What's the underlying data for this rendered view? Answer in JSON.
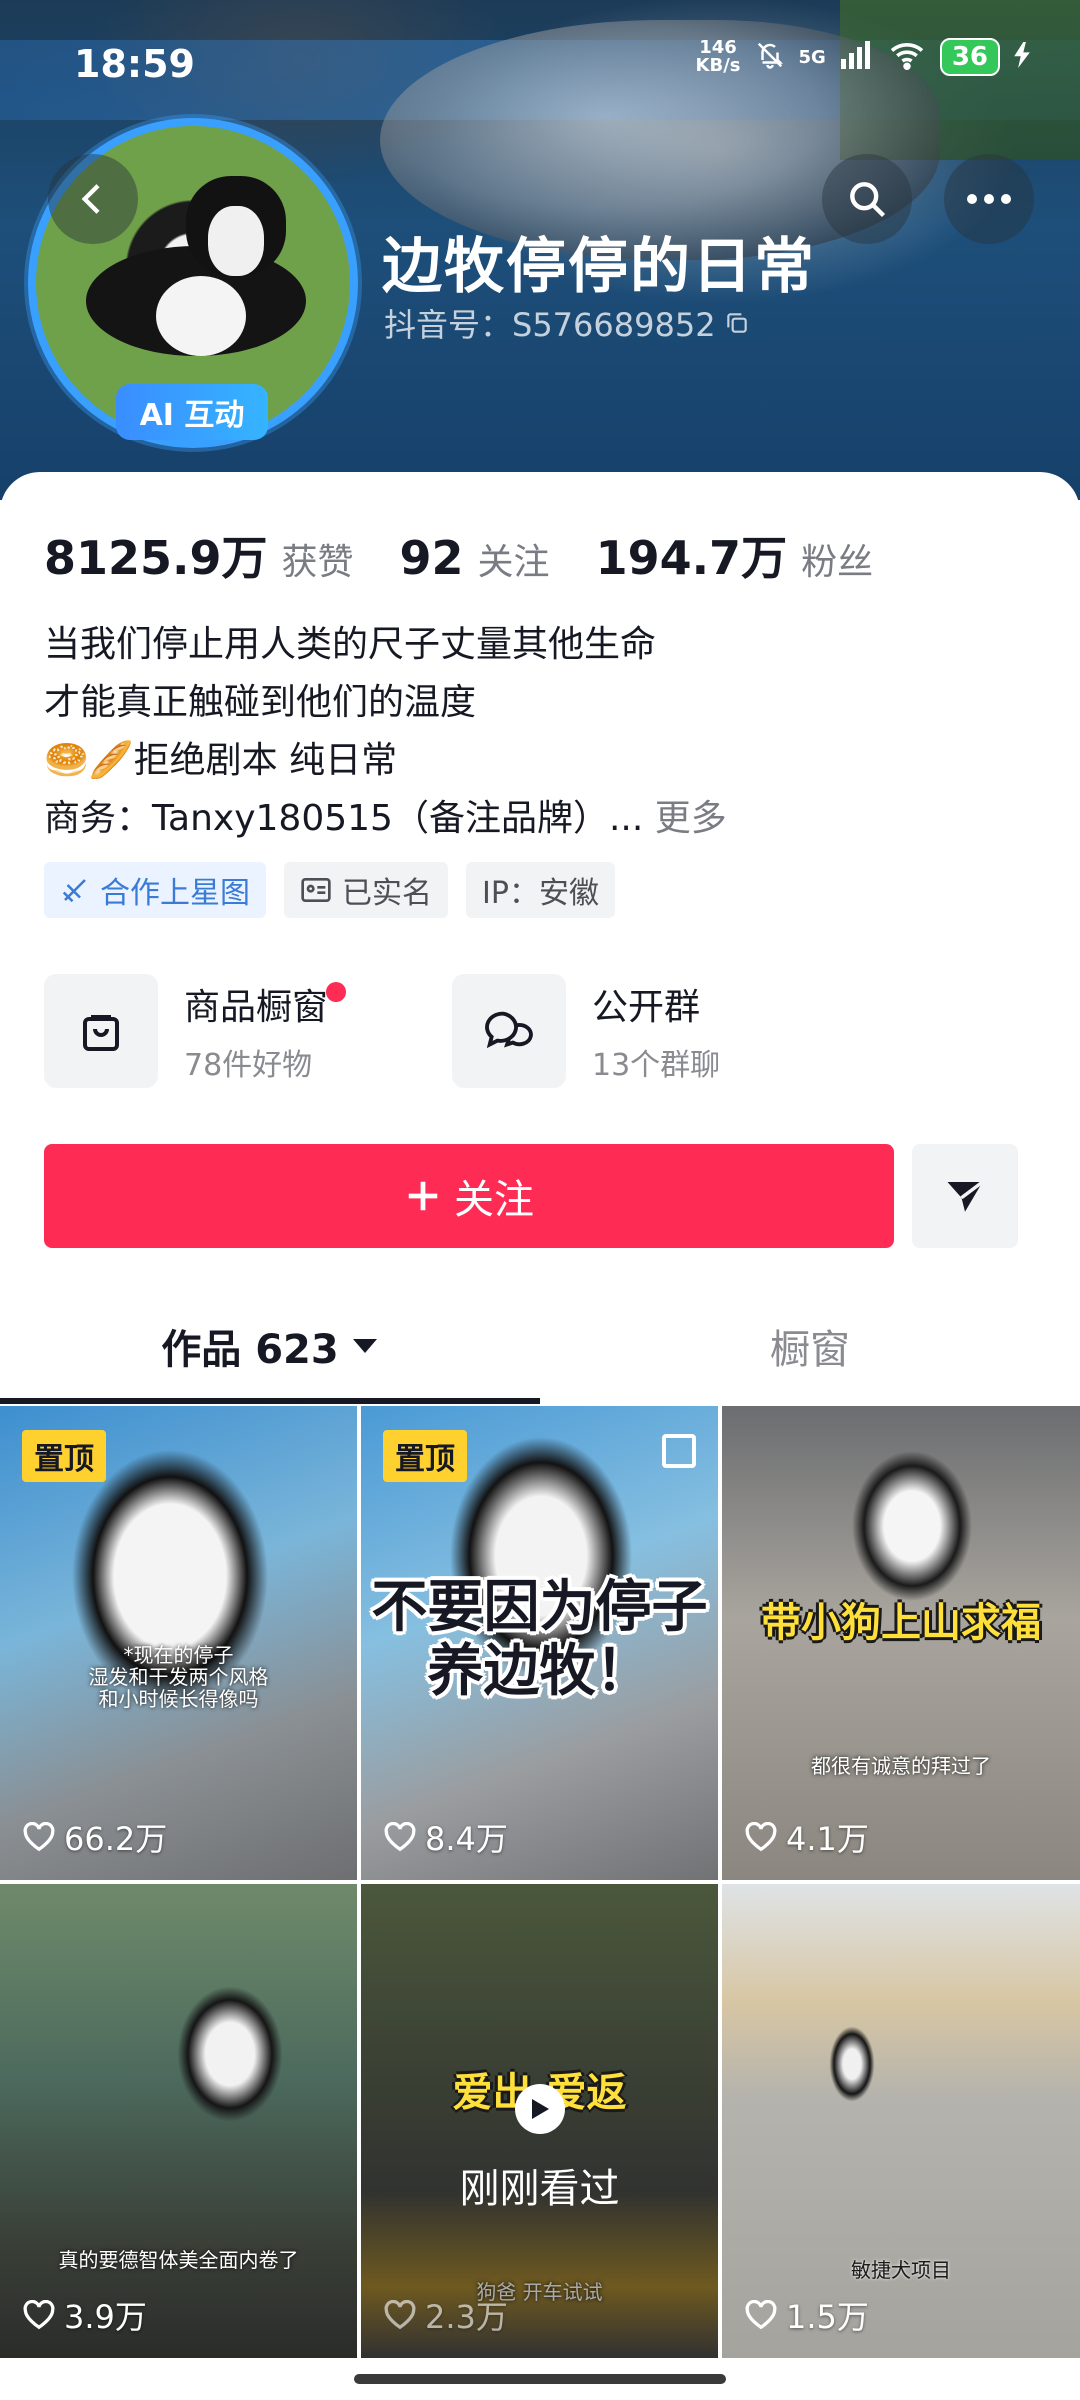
{
  "status_bar": {
    "time": "18:59",
    "net_speed_value": "146",
    "net_speed_unit": "KB/s",
    "network": "5G",
    "battery": "36"
  },
  "profile": {
    "name": "边牧停停的日常",
    "douyin_id": "抖音号：S576689852",
    "ai_badge": "AI 互动"
  },
  "stats": [
    {
      "num": "8125.9万",
      "label": "获赞"
    },
    {
      "num": "92",
      "label": "关注"
    },
    {
      "num": "194.7万",
      "label": "粉丝"
    }
  ],
  "bio": {
    "line1": "当我们停止用人类的尺子丈量其他生命",
    "line2": "才能真正触碰到他们的温度",
    "line3_emoji": "🥯🥖",
    "line3": "拒绝剧本 纯日常",
    "line4": "商务：Tanxy180515（备注品牌）...",
    "more": "更多"
  },
  "tags": {
    "star": "合作上星图",
    "realname": "已实名",
    "ip": "IP：安徽"
  },
  "services": {
    "shop_title": "商品橱窗",
    "shop_sub": "78件好物",
    "group_title": "公开群",
    "group_sub": "13个群聊"
  },
  "actions": {
    "follow": "关注"
  },
  "tabs": {
    "works": "作品 623",
    "window": "橱窗"
  },
  "videos": [
    {
      "pinned": "置顶",
      "likes": "66.2万",
      "caption": "*现在的停子\n湿发和干发两个风格\n和小时候长得像吗"
    },
    {
      "pinned": "置顶",
      "likes": "8.4万",
      "caption_big": "不要因为停子\n养边牧！"
    },
    {
      "likes": "4.1万",
      "caption_yellow": "带小狗上山求福",
      "caption_small": "都很有诚意的拜过了"
    },
    {
      "likes": "3.9万",
      "caption_small": "真的要德智体美全面内卷了"
    },
    {
      "likes": "2.3万",
      "caption_yellow": "爱出 爱返",
      "seen": "刚刚看过",
      "caption_small": "狗爸 开车试试"
    },
    {
      "likes": "1.5万",
      "caption_small": "敏捷犬项目"
    }
  ]
}
